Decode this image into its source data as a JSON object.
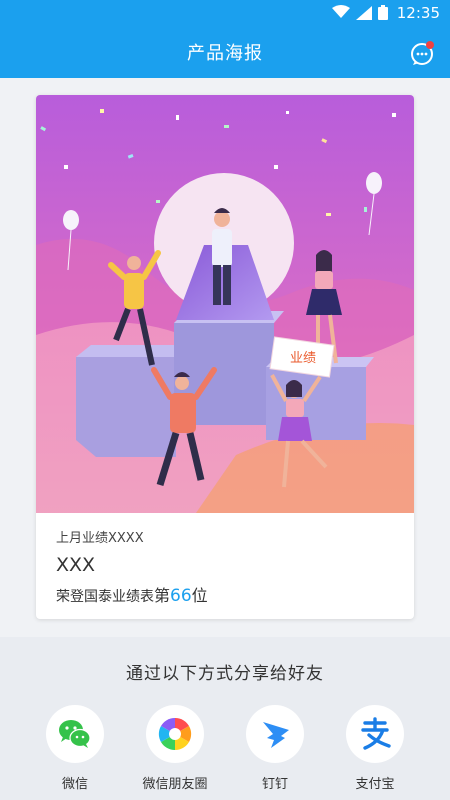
{
  "status_bar": {
    "time": "12:35"
  },
  "nav": {
    "title": "产品海报"
  },
  "poster": {
    "sign_text": "业绩"
  },
  "card": {
    "line1": "上月业绩XXXX",
    "name": "XXX",
    "rank_prefix": "荣登国泰业绩表",
    "rank_di": "第",
    "rank_number": "66",
    "rank_suffix": "位"
  },
  "share": {
    "title": "通过以下方式分享给好友",
    "items": [
      {
        "label": "微信",
        "icon": "wechat-icon",
        "color": "#35c24a"
      },
      {
        "label": "微信朋友圈",
        "icon": "moments-icon",
        "color": "#ff9d1c"
      },
      {
        "label": "钉钉",
        "icon": "dingtalk-icon",
        "color": "#2d8ef5"
      },
      {
        "label": "支付宝",
        "icon": "alipay-icon",
        "color": "#1a7de6"
      }
    ]
  },
  "colors": {
    "primary": "#1ba0ee",
    "rank": "#1ba0ee",
    "badge": "#f04141"
  }
}
